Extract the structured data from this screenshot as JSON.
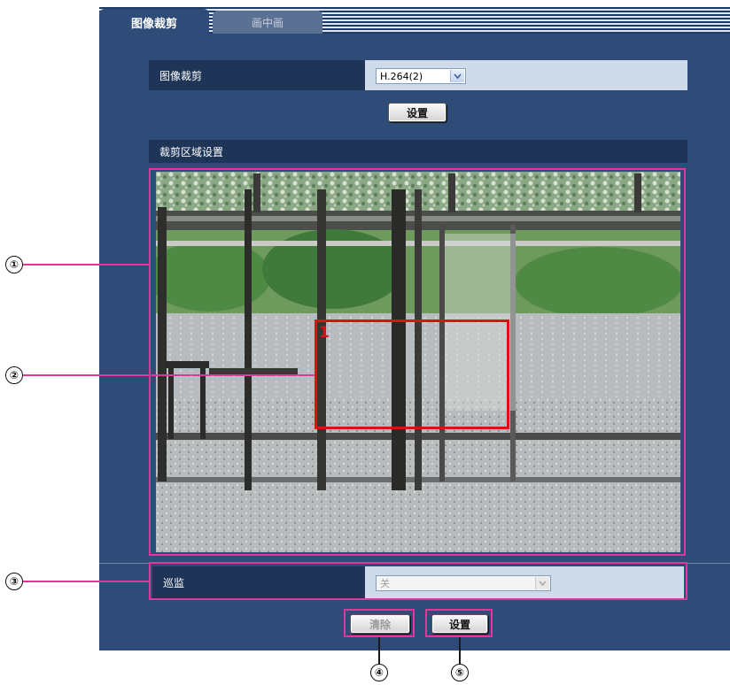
{
  "tabs": [
    {
      "label": "图像裁剪",
      "active": true
    },
    {
      "label": "画中画",
      "active": false
    }
  ],
  "image_crop_row": {
    "label": "图像裁剪",
    "select_value": "H.264(2)"
  },
  "set_button_top": "设置",
  "crop_area_section": {
    "title": "裁剪区域设置",
    "region_number": "1"
  },
  "patrol_row": {
    "label": "巡监",
    "select_value": "关"
  },
  "buttons": {
    "clear_label": "清除",
    "set_label": "设置"
  },
  "callouts": [
    "①",
    "②",
    "③",
    "④",
    "⑤"
  ],
  "colors": {
    "panel": "#2f4c78",
    "row_dark": "#1e3558",
    "row_light": "#cfdaea",
    "highlight": "#e0389a",
    "crop_rect": "#e01010"
  }
}
